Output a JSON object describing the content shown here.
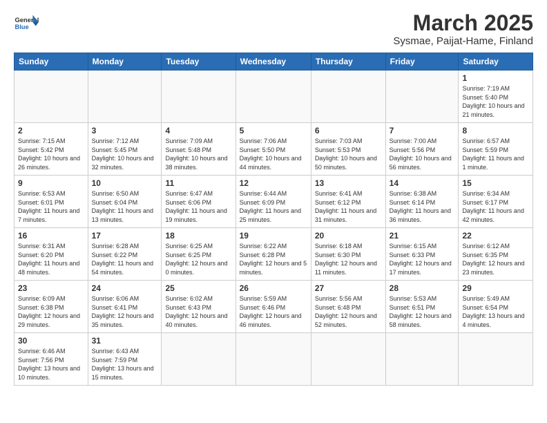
{
  "header": {
    "logo_general": "General",
    "logo_blue": "Blue",
    "title": "March 2025",
    "subtitle": "Sysmae, Paijat-Hame, Finland"
  },
  "weekdays": [
    "Sunday",
    "Monday",
    "Tuesday",
    "Wednesday",
    "Thursday",
    "Friday",
    "Saturday"
  ],
  "weeks": [
    [
      {
        "day": "",
        "info": ""
      },
      {
        "day": "",
        "info": ""
      },
      {
        "day": "",
        "info": ""
      },
      {
        "day": "",
        "info": ""
      },
      {
        "day": "",
        "info": ""
      },
      {
        "day": "",
        "info": ""
      },
      {
        "day": "1",
        "info": "Sunrise: 7:19 AM\nSunset: 5:40 PM\nDaylight: 10 hours\nand 21 minutes."
      }
    ],
    [
      {
        "day": "2",
        "info": "Sunrise: 7:15 AM\nSunset: 5:42 PM\nDaylight: 10 hours\nand 26 minutes."
      },
      {
        "day": "3",
        "info": "Sunrise: 7:12 AM\nSunset: 5:45 PM\nDaylight: 10 hours\nand 32 minutes."
      },
      {
        "day": "4",
        "info": "Sunrise: 7:09 AM\nSunset: 5:48 PM\nDaylight: 10 hours\nand 38 minutes."
      },
      {
        "day": "5",
        "info": "Sunrise: 7:06 AM\nSunset: 5:50 PM\nDaylight: 10 hours\nand 44 minutes."
      },
      {
        "day": "6",
        "info": "Sunrise: 7:03 AM\nSunset: 5:53 PM\nDaylight: 10 hours\nand 50 minutes."
      },
      {
        "day": "7",
        "info": "Sunrise: 7:00 AM\nSunset: 5:56 PM\nDaylight: 10 hours\nand 56 minutes."
      },
      {
        "day": "8",
        "info": "Sunrise: 6:57 AM\nSunset: 5:59 PM\nDaylight: 11 hours\nand 1 minute."
      }
    ],
    [
      {
        "day": "9",
        "info": "Sunrise: 6:53 AM\nSunset: 6:01 PM\nDaylight: 11 hours\nand 7 minutes."
      },
      {
        "day": "10",
        "info": "Sunrise: 6:50 AM\nSunset: 6:04 PM\nDaylight: 11 hours\nand 13 minutes."
      },
      {
        "day": "11",
        "info": "Sunrise: 6:47 AM\nSunset: 6:06 PM\nDaylight: 11 hours\nand 19 minutes."
      },
      {
        "day": "12",
        "info": "Sunrise: 6:44 AM\nSunset: 6:09 PM\nDaylight: 11 hours\nand 25 minutes."
      },
      {
        "day": "13",
        "info": "Sunrise: 6:41 AM\nSunset: 6:12 PM\nDaylight: 11 hours\nand 31 minutes."
      },
      {
        "day": "14",
        "info": "Sunrise: 6:38 AM\nSunset: 6:14 PM\nDaylight: 11 hours\nand 36 minutes."
      },
      {
        "day": "15",
        "info": "Sunrise: 6:34 AM\nSunset: 6:17 PM\nDaylight: 11 hours\nand 42 minutes."
      }
    ],
    [
      {
        "day": "16",
        "info": "Sunrise: 6:31 AM\nSunset: 6:20 PM\nDaylight: 11 hours\nand 48 minutes."
      },
      {
        "day": "17",
        "info": "Sunrise: 6:28 AM\nSunset: 6:22 PM\nDaylight: 11 hours\nand 54 minutes."
      },
      {
        "day": "18",
        "info": "Sunrise: 6:25 AM\nSunset: 6:25 PM\nDaylight: 12 hours\nand 0 minutes."
      },
      {
        "day": "19",
        "info": "Sunrise: 6:22 AM\nSunset: 6:28 PM\nDaylight: 12 hours\nand 5 minutes."
      },
      {
        "day": "20",
        "info": "Sunrise: 6:18 AM\nSunset: 6:30 PM\nDaylight: 12 hours\nand 11 minutes."
      },
      {
        "day": "21",
        "info": "Sunrise: 6:15 AM\nSunset: 6:33 PM\nDaylight: 12 hours\nand 17 minutes."
      },
      {
        "day": "22",
        "info": "Sunrise: 6:12 AM\nSunset: 6:35 PM\nDaylight: 12 hours\nand 23 minutes."
      }
    ],
    [
      {
        "day": "23",
        "info": "Sunrise: 6:09 AM\nSunset: 6:38 PM\nDaylight: 12 hours\nand 29 minutes."
      },
      {
        "day": "24",
        "info": "Sunrise: 6:06 AM\nSunset: 6:41 PM\nDaylight: 12 hours\nand 35 minutes."
      },
      {
        "day": "25",
        "info": "Sunrise: 6:02 AM\nSunset: 6:43 PM\nDaylight: 12 hours\nand 40 minutes."
      },
      {
        "day": "26",
        "info": "Sunrise: 5:59 AM\nSunset: 6:46 PM\nDaylight: 12 hours\nand 46 minutes."
      },
      {
        "day": "27",
        "info": "Sunrise: 5:56 AM\nSunset: 6:48 PM\nDaylight: 12 hours\nand 52 minutes."
      },
      {
        "day": "28",
        "info": "Sunrise: 5:53 AM\nSunset: 6:51 PM\nDaylight: 12 hours\nand 58 minutes."
      },
      {
        "day": "29",
        "info": "Sunrise: 5:49 AM\nSunset: 6:54 PM\nDaylight: 13 hours\nand 4 minutes."
      }
    ],
    [
      {
        "day": "30",
        "info": "Sunrise: 6:46 AM\nSunset: 7:56 PM\nDaylight: 13 hours\nand 10 minutes."
      },
      {
        "day": "31",
        "info": "Sunrise: 6:43 AM\nSunset: 7:59 PM\nDaylight: 13 hours\nand 15 minutes."
      },
      {
        "day": "",
        "info": ""
      },
      {
        "day": "",
        "info": ""
      },
      {
        "day": "",
        "info": ""
      },
      {
        "day": "",
        "info": ""
      },
      {
        "day": "",
        "info": ""
      }
    ]
  ]
}
